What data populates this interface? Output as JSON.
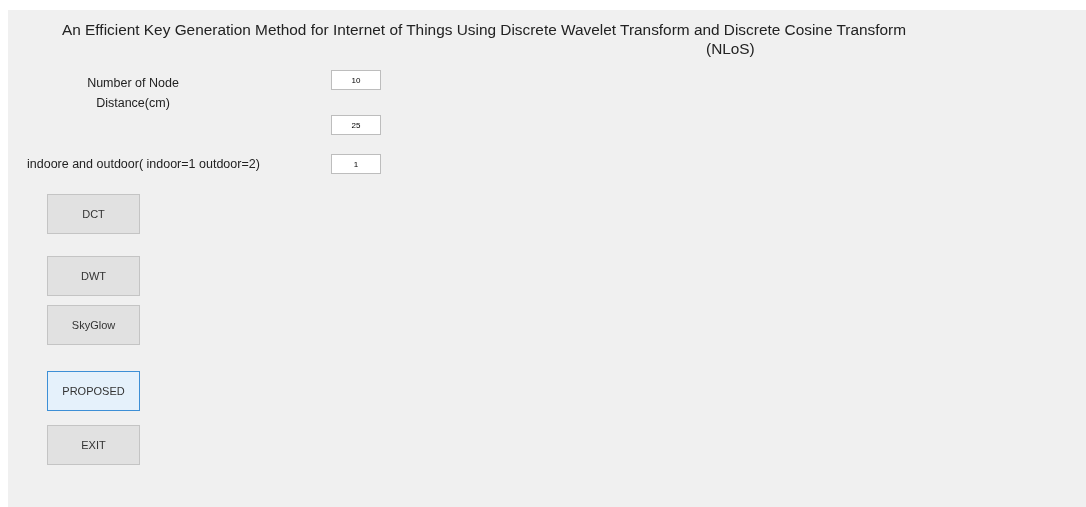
{
  "title_lines": [
    "An Efficient Key Generation Method for Internet of Things Using Discrete Wavelet Transform and Discrete Cosine Transform",
    "(NLoS)"
  ],
  "fields": [
    {
      "label": "Number of Node",
      "value": "10"
    },
    {
      "label": "Distance(cm)",
      "value": "25"
    },
    {
      "label": "indoore and outdoor( indoor=1 outdoor=2)",
      "value": "1"
    }
  ],
  "buttons": [
    {
      "label": "DCT",
      "selected": false
    },
    {
      "label": "DWT",
      "selected": false
    },
    {
      "label": "SkyGlow",
      "selected": false
    },
    {
      "label": "PROPOSED",
      "selected": true
    },
    {
      "label": "EXIT",
      "selected": false
    }
  ]
}
